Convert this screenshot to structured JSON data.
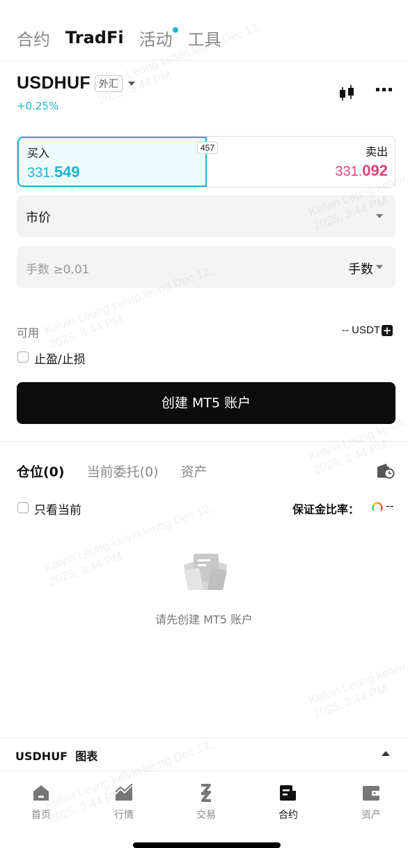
{
  "top_tabs": [
    {
      "label": "合约",
      "active": false,
      "dot": false
    },
    {
      "label": "TradFi",
      "active": true,
      "dot": false
    },
    {
      "label": "活动",
      "active": false,
      "dot": true
    },
    {
      "label": "工具",
      "active": false,
      "dot": false
    }
  ],
  "symbol": {
    "name": "USDHUF",
    "market": "外汇",
    "change": "+0.25%"
  },
  "trade": {
    "buy_label": "买入",
    "buy_price_prefix": "331.",
    "buy_price_main": "549",
    "sell_label": "卖出",
    "sell_price_prefix": "331.",
    "sell_price_main": "092",
    "spread": "457"
  },
  "order_type": "市价",
  "lots": {
    "placeholder": "手数 ≥0.01",
    "unit": "手数"
  },
  "available": {
    "label": "可用",
    "value": "-- USDT"
  },
  "tp_sl": "止盈/止损",
  "cta": "创建 MT5 账户",
  "positions": {
    "tabs": [
      "仓位(0)",
      "当前委托(0)",
      "资产"
    ],
    "only_current": "只看当前",
    "margin_ratio_label": "保证金比率：",
    "margin_ratio_value": "--",
    "empty_text": "请先创建 MT5 账户"
  },
  "chart_bar": "USDHUF  图表",
  "bottom_nav": [
    {
      "label": "首页",
      "icon": "home-icon",
      "active": false
    },
    {
      "label": "行情",
      "icon": "chart-icon",
      "active": false
    },
    {
      "label": "交易",
      "icon": "exchange-icon",
      "active": false
    },
    {
      "label": "合约",
      "icon": "contract-icon",
      "active": true
    },
    {
      "label": "资产",
      "icon": "wallet-icon",
      "active": false
    }
  ],
  "watermark": [
    "Kelvin Leung kelvin.leung Dec 12,",
    "2025, 3:44 PM"
  ],
  "colors": {
    "accent": "#1fb4cf",
    "sell": "#e8417c"
  }
}
